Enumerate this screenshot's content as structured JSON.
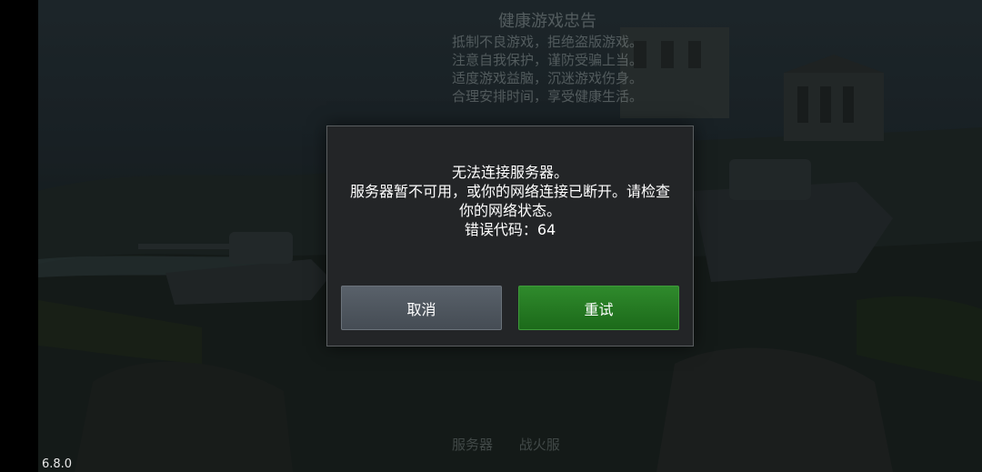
{
  "background": {
    "health_notice": {
      "title": "健康游戏忠告",
      "lines": [
        "抵制不良游戏，拒绝盗版游戏。",
        "注意自我保护，谨防受骗上当。",
        "适度游戏益脑，沉迷游戏伤身。",
        "合理安排时间，享受健康生活。"
      ]
    },
    "bottom_links": [
      "服务器",
      "战火服"
    ]
  },
  "version": "6.8.0",
  "dialog": {
    "message_lines": [
      "无法连接服务器。",
      "服务器暂不可用，或你的网络连接已断开。请检查",
      "你的网络状态。",
      "错误代码：64"
    ],
    "cancel_label": "取消",
    "retry_label": "重试"
  },
  "colors": {
    "dialog_bg": "#232527",
    "cancel_button": "#4f575f",
    "retry_button": "#267a23"
  }
}
